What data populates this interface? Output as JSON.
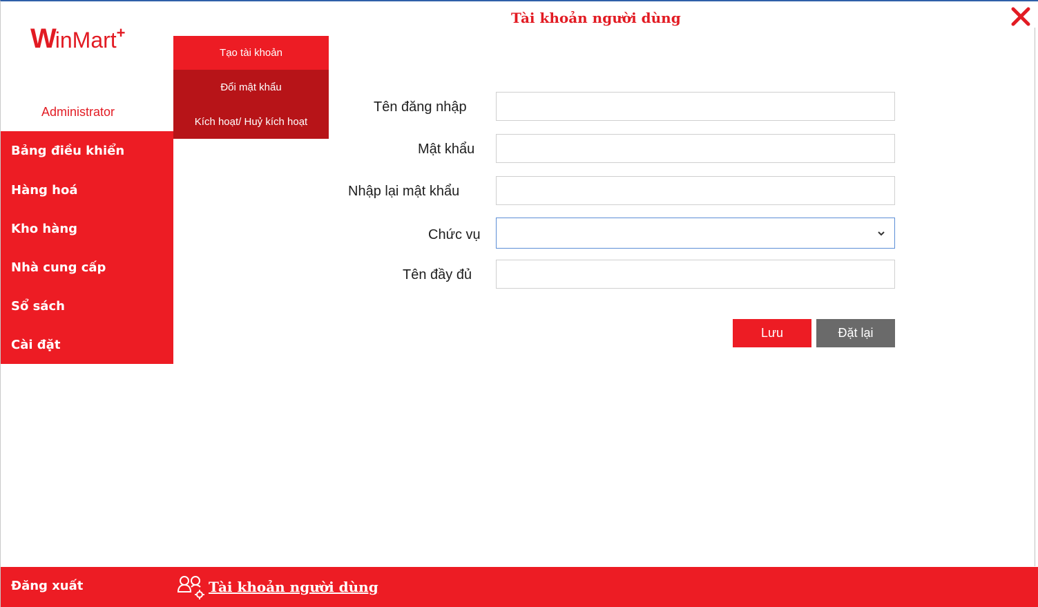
{
  "window": {
    "title": "Tài khoản người dùng",
    "close_icon": "close-icon"
  },
  "brand": {
    "logo_main": "W",
    "logo_rest": "inMart",
    "logo_plus": "+",
    "user_role": "Administrator"
  },
  "sidebar": {
    "items": [
      {
        "label": "Bảng điều khiển"
      },
      {
        "label": "Hàng hoá"
      },
      {
        "label": "Kho hàng"
      },
      {
        "label": "Nhà cung cấp"
      },
      {
        "label": "Sổ sách"
      },
      {
        "label": "Cài đặt"
      }
    ]
  },
  "submenu": {
    "items": [
      {
        "label": "Tạo tài khoản",
        "active": true
      },
      {
        "label": "Đổi mật khẩu",
        "active": false
      },
      {
        "label": "Kích hoạt/ Huỷ kích hoạt",
        "active": false
      }
    ]
  },
  "form": {
    "username_label": "Tên đăng nhập",
    "username_value": "",
    "password_label": "Mật khẩu",
    "password_value": "",
    "confirm_password_label": "Nhập lại mật khẩu",
    "confirm_password_value": "",
    "role_label": "Chức vụ",
    "role_value": "",
    "fullname_label": "Tên đầy đủ",
    "fullname_value": "",
    "save_label": "Lưu",
    "reset_label": "Đặt lại"
  },
  "footer": {
    "logout_label": "Đăng xuất",
    "section_icon": "user-settings-icon",
    "section_link": "Tài khoản người dùng"
  },
  "colors": {
    "brand_red": "#ed1c24",
    "submenu_dark_red": "#b71418",
    "reset_gray": "#6a6a6a",
    "focus_blue": "#5b8dd6"
  }
}
